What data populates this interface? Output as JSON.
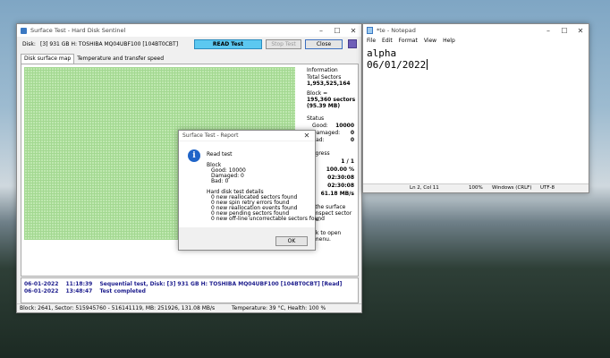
{
  "hds": {
    "title": "Surface Test - Hard Disk Sentinel",
    "disk_label": "Disk:",
    "disk_value": "[3] 931 GB H: TOSHIBA MQ04UBF100 [104BT0CBT]",
    "buttons": {
      "read": "READ Test",
      "stop": "Stop Test",
      "close": "Close"
    },
    "tabs": [
      "Disk surface map",
      "Temperature and transfer speed"
    ],
    "info": {
      "heading": "Information",
      "total_sectors_label": "Total Sectors",
      "total_sectors_value": "1,953,525,164",
      "block_label": "Block =",
      "block_sectors": "195,360 sectors",
      "block_mb": "(95.39 MB)",
      "status_heading": "Status",
      "good_label": "Good:",
      "good_value": "10000",
      "damaged_label": "Damaged:",
      "damaged_value": "0",
      "bad_label": "Bad:",
      "bad_value": "0",
      "progress_heading": "Progress",
      "progress_rows": [
        "1 / 1",
        "100.00 %",
        "02:30:08",
        "02:30:08",
        "61.18 MB/s"
      ],
      "note1_lines": [
        "on the surface",
        "to inspect sector",
        "ents."
      ],
      "note2_lines": [
        "click to open",
        "xt menu."
      ]
    },
    "log": [
      {
        "date": "06-01-2022",
        "time": "11:18:39",
        "text": "Sequential test, Disk: [3] 931 GB H: TOSHIBA MQ04UBF100 [104BT0CBT] [Read]"
      },
      {
        "date": "06-01-2022",
        "time": "13:48:47",
        "text": "Test completed"
      }
    ],
    "statusbar": {
      "left": "Block: 2641, Sector: 515945760 - 516141119, MB: 251926, 131.08 MB/s",
      "right": "Temperature: 39 °C, Health: 100 %"
    }
  },
  "report": {
    "title": "Surface Test - Report",
    "heading": "Read test",
    "block_label": "Block",
    "good_line": "Good: 10000",
    "damaged_line": "Damaged: 0",
    "bad_line": "Bad: 0",
    "details_heading": "Hard disk test details",
    "details": [
      "0 new reallocated sectors found",
      "0 new spin retry errors found",
      "0 new reallocation events found",
      "0 new pending sectors found",
      "0 new off-line uncorrectable sectors found"
    ],
    "ok": "OK"
  },
  "notepad": {
    "title": "*te - Notepad",
    "menu": [
      "File",
      "Edit",
      "Format",
      "View",
      "Help"
    ],
    "lines": [
      "alpha",
      "06/01/2022"
    ],
    "status": {
      "pos": "Ln 2, Col 11",
      "zoom": "100%",
      "eol": "Windows (CRLF)",
      "enc": "UTF-8"
    }
  }
}
